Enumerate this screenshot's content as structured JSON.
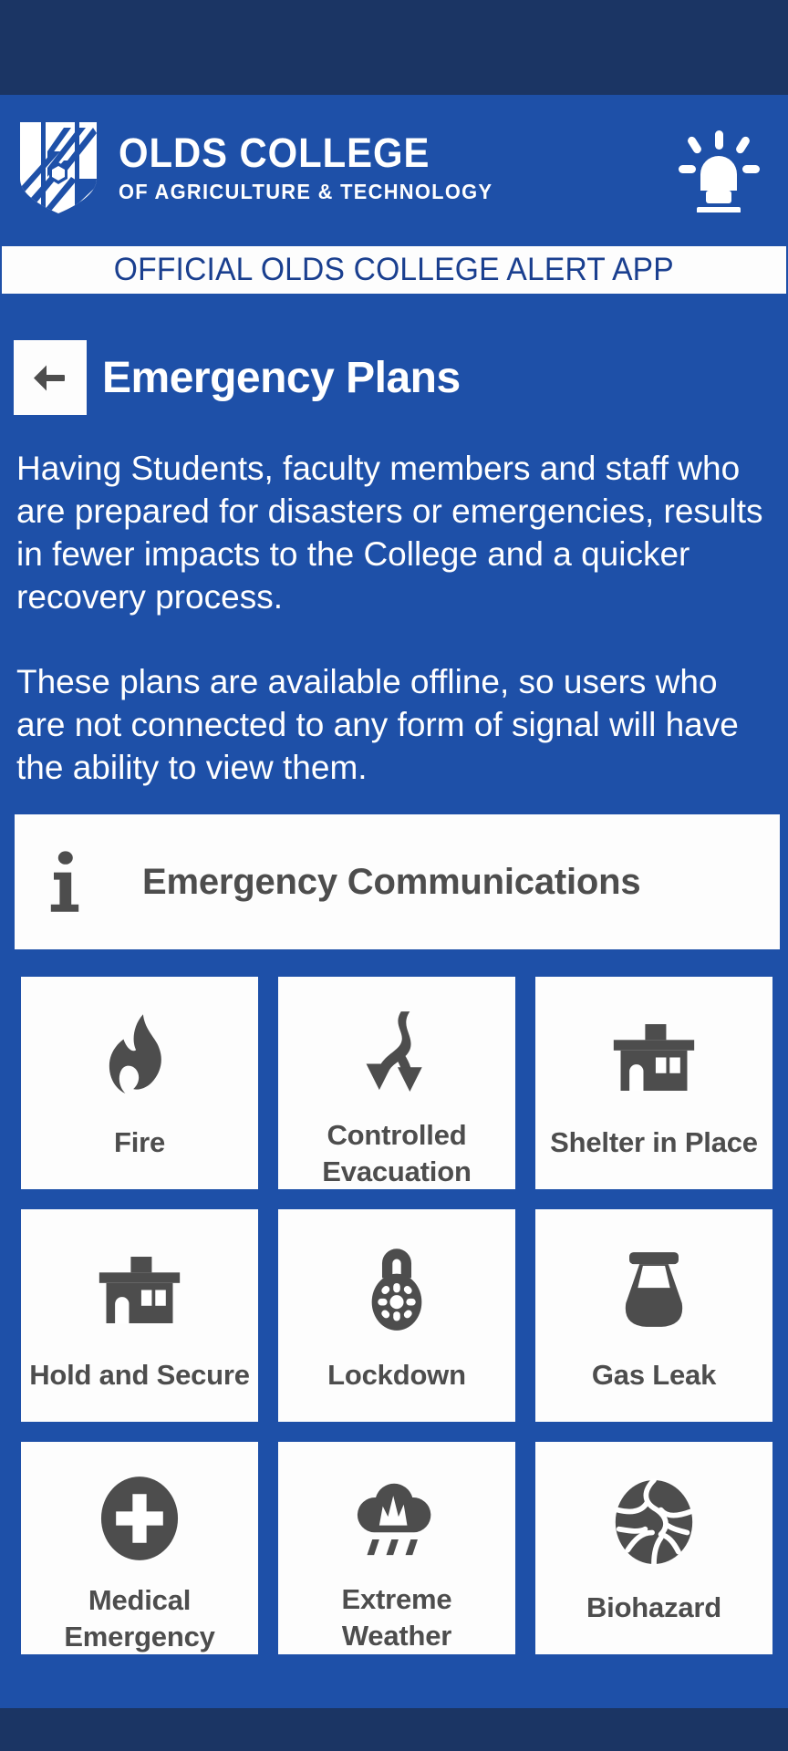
{
  "colors": {
    "brand_blue": "#1e50a8",
    "dark_navy": "#1b3564",
    "card_white": "#fdfdfd",
    "icon_gray": "#4d4d4d",
    "banner_text_blue": "#1a3f8f"
  },
  "header": {
    "logo_icon": "olds-college-shield-logo",
    "brand_line1": "OLDS COLLEGE",
    "brand_line2": "OF AGRICULTURE & TECHNOLOGY",
    "siren_icon": "emergency-siren-icon"
  },
  "alert_banner": {
    "text": "OFFICIAL OLDS COLLEGE ALERT APP"
  },
  "page": {
    "back_icon": "arrow-left-icon",
    "title": "Emergency Plans",
    "paragraphs": [
      "Having Students, faculty members and staff who are prepared for disasters or emergencies, results in fewer impacts to the College and a quicker recovery process.",
      "These plans are available offline, so users who are not connected to any form of signal will have the ability to view them."
    ]
  },
  "communications_card": {
    "icon": "info-icon",
    "label": "Emergency Communications"
  },
  "tiles": [
    {
      "label": "Fire",
      "icon": "flame-icon"
    },
    {
      "label": "Controlled Evacuation",
      "icon": "evacuation-arrows-icon"
    },
    {
      "label": "Shelter in Place",
      "icon": "building-shelter-icon"
    },
    {
      "label": "Hold and Secure",
      "icon": "building-shelter-icon"
    },
    {
      "label": "Lockdown",
      "icon": "padlock-icon"
    },
    {
      "label": "Gas Leak",
      "icon": "gas-container-icon"
    },
    {
      "label": "Medical Emergency",
      "icon": "medical-cross-icon"
    },
    {
      "label": "Extreme Weather",
      "icon": "rain-cloud-icon"
    },
    {
      "label": "Biohazard",
      "icon": "biohazard-globe-icon"
    }
  ]
}
